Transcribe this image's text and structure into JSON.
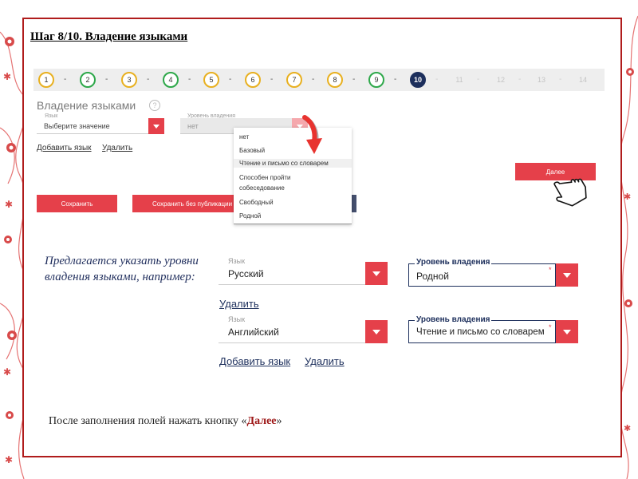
{
  "slide": {
    "title": "Шаг 8/10.  Владение языками",
    "intro": "Предлагается указать уровни владения языками, например:",
    "footer_prefix": "После заполнения полей нажать кнопку «",
    "footer_accent": "Далее",
    "footer_suffix": "»"
  },
  "stepper": {
    "steps": [
      "1",
      "2",
      "3",
      "4",
      "5",
      "6",
      "7",
      "8",
      "9",
      "10",
      "11",
      "12",
      "13",
      "14"
    ],
    "current": "10"
  },
  "form": {
    "title": "Владение языками",
    "help": "?",
    "language_label": "Язык",
    "language_value": "Выберите значение",
    "level_label": "Уровень владения",
    "level_value": "нет",
    "add_language": "Добавить язык",
    "remove": "Удалить",
    "next_button": "Далее",
    "save_button": "Сохранить",
    "save_no_publish_button": "Сохранить без публикации"
  },
  "dropdown": {
    "options": [
      "нет",
      "Базовый",
      "Чтение и письмо со словарем",
      "Способен пройти",
      "собеседование",
      "Свободный",
      "Родной"
    ]
  },
  "example": {
    "language_label": "Язык",
    "level_label": "Уровень владения",
    "row1_language": "Русский",
    "row1_level": "Родной",
    "row2_language": "Английский",
    "row2_level": "Чтение и письмо со словарем",
    "remove": "Удалить",
    "add_language": "Добавить язык",
    "required": "*"
  },
  "colors": {
    "accent_red": "#e5404a",
    "frame_red": "#b01c1c",
    "navy": "#1d2f5c",
    "step_yellow": "#e8b020",
    "step_green": "#2ea84a"
  },
  "icons": [
    "help-icon",
    "chevron-down-icon",
    "red-arrow-icon",
    "hand-pointer-icon"
  ]
}
